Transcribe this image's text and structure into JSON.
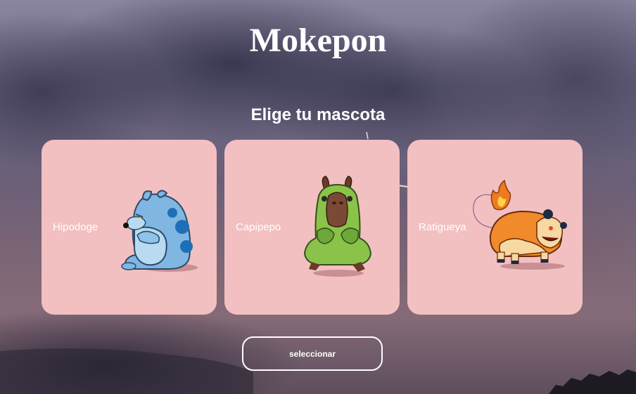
{
  "header": {
    "title": "Mokepon"
  },
  "selection": {
    "heading": "Elige tu mascota",
    "pets": [
      {
        "name": "Hipodoge",
        "image": "hipodoge-creature-blue"
      },
      {
        "name": "Capipepo",
        "image": "capipepo-creature-green"
      },
      {
        "name": "Ratigueya",
        "image": "ratigueya-creature-orange"
      }
    ],
    "card_color": "#f2c0c0"
  },
  "actions": {
    "select_label": "seleccionar"
  }
}
